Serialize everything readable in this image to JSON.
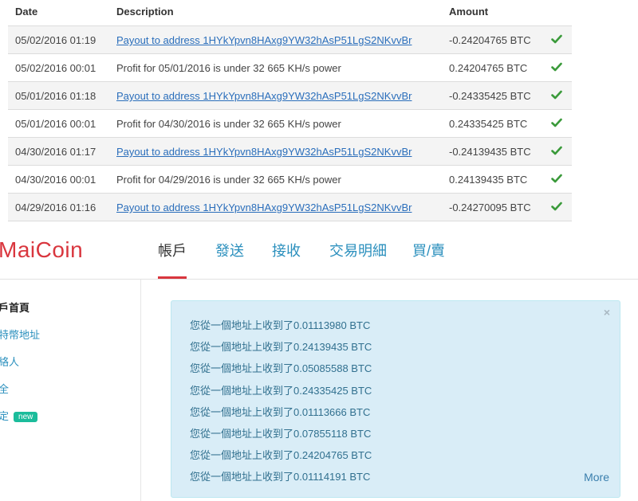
{
  "transactions": {
    "headers": {
      "date": "Date",
      "description": "Description",
      "amount": "Amount"
    },
    "rows": [
      {
        "date": "05/02/2016 01:19",
        "description": "Payout to address 1HYkYpvn8HAxg9YW32hAsP51LgS2NKvvBr",
        "amount": "-0.24204765 BTC",
        "is_link": true
      },
      {
        "date": "05/02/2016 00:01",
        "description": "Profit for 05/01/2016 is under 32 665 KH/s power",
        "amount": "0.24204765 BTC",
        "is_link": false
      },
      {
        "date": "05/01/2016 01:18",
        "description": "Payout to address 1HYkYpvn8HAxg9YW32hAsP51LgS2NKvvBr",
        "amount": "-0.24335425 BTC",
        "is_link": true
      },
      {
        "date": "05/01/2016 00:01",
        "description": "Profit for 04/30/2016 is under 32 665 KH/s power",
        "amount": "0.24335425 BTC",
        "is_link": false
      },
      {
        "date": "04/30/2016 01:17",
        "description": "Payout to address 1HYkYpvn8HAxg9YW32hAsP51LgS2NKvvBr",
        "amount": "-0.24139435 BTC",
        "is_link": true
      },
      {
        "date": "04/30/2016 00:01",
        "description": "Profit for 04/29/2016 is under 32 665 KH/s power",
        "amount": "0.24139435 BTC",
        "is_link": false
      },
      {
        "date": "04/29/2016 01:16",
        "description": "Payout to address 1HYkYpvn8HAxg9YW32hAsP51LgS2NKvvBr",
        "amount": "-0.24270095 BTC",
        "is_link": true
      }
    ],
    "status_icon": "check-icon",
    "check_color": "#3a9a3a"
  },
  "app": {
    "logo": "MaiCoin",
    "brand_color": "#d9363e"
  },
  "nav": {
    "tabs": [
      "帳戶",
      "發送",
      "接收",
      "交易明細",
      "買/賣"
    ],
    "active_index": 0
  },
  "sidebar": {
    "items": [
      {
        "label": "戶首頁",
        "active": true
      },
      {
        "label": "特幣地址",
        "active": false
      },
      {
        "label": "絡人",
        "active": false
      },
      {
        "label": "全",
        "active": false
      },
      {
        "label": "定",
        "active": false,
        "badge": "new"
      }
    ]
  },
  "notifications": {
    "close_symbol": "×",
    "lines": [
      "您從一個地址上收到了0.01113980 BTC",
      "您從一個地址上收到了0.24139435 BTC",
      "您從一個地址上收到了0.05085588 BTC",
      "您從一個地址上收到了0.24335425 BTC",
      "您從一個地址上收到了0.01113666 BTC",
      "您從一個地址上收到了0.07855118 BTC",
      "您從一個地址上收到了0.24204765 BTC",
      "您從一個地址上收到了0.01114191 BTC"
    ],
    "more_label": "More"
  }
}
